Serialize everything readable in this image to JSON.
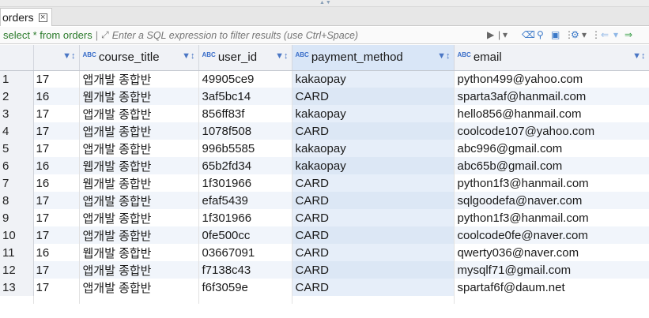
{
  "tab": {
    "label": "orders"
  },
  "filter": {
    "query": "select * from orders",
    "placeholder": "Enter a SQL expression to filter results (use Ctrl+Space)"
  },
  "columns": [
    {
      "label": "",
      "type": ""
    },
    {
      "label": "course_title",
      "type": "ABC"
    },
    {
      "label": "user_id",
      "type": "ABC"
    },
    {
      "label": "payment_method",
      "type": "ABC"
    },
    {
      "label": "email",
      "type": "ABC"
    }
  ],
  "rows": [
    {
      "rn": "1",
      "num": "17",
      "course_title": "앱개발 종합반",
      "user_id": "49905ce9",
      "payment_method": "kakaopay",
      "email": "python499@yahoo.com"
    },
    {
      "rn": "2",
      "num": "16",
      "course_title": "웹개발 종합반",
      "user_id": "3af5bc14",
      "payment_method": "CARD",
      "email": "sparta3af@hanmail.com"
    },
    {
      "rn": "3",
      "num": "17",
      "course_title": "앱개발 종합반",
      "user_id": "856ff83f",
      "payment_method": "kakaopay",
      "email": "hello856@hanmail.com"
    },
    {
      "rn": "4",
      "num": "17",
      "course_title": "앱개발 종합반",
      "user_id": "1078f508",
      "payment_method": "CARD",
      "email": "coolcode107@yahoo.com"
    },
    {
      "rn": "5",
      "num": "17",
      "course_title": "앱개발 종합반",
      "user_id": "996b5585",
      "payment_method": "kakaopay",
      "email": "abc996@gmail.com"
    },
    {
      "rn": "6",
      "num": "16",
      "course_title": "웹개발 종합반",
      "user_id": "65b2fd34",
      "payment_method": "kakaopay",
      "email": "abc65b@gmail.com"
    },
    {
      "rn": "7",
      "num": "16",
      "course_title": "웹개발 종합반",
      "user_id": "1f301966",
      "payment_method": "CARD",
      "email": "python1f3@hanmail.com"
    },
    {
      "rn": "8",
      "num": "17",
      "course_title": "앱개발 종합반",
      "user_id": "efaf5439",
      "payment_method": "CARD",
      "email": "sqlgoodefa@naver.com"
    },
    {
      "rn": "9",
      "num": "17",
      "course_title": "앱개발 종합반",
      "user_id": "1f301966",
      "payment_method": "CARD",
      "email": "python1f3@hanmail.com"
    },
    {
      "rn": "10",
      "num": "17",
      "course_title": "앱개발 종합반",
      "user_id": "0fe500cc",
      "payment_method": "CARD",
      "email": "coolcode0fe@naver.com"
    },
    {
      "rn": "11",
      "num": "16",
      "course_title": "웹개발 종합반",
      "user_id": "03667091",
      "payment_method": "CARD",
      "email": "qwerty036@naver.com"
    },
    {
      "rn": "12",
      "num": "17",
      "course_title": "앱개발 종합반",
      "user_id": "f7138c43",
      "payment_method": "CARD",
      "email": "mysqlf71@gmail.com"
    },
    {
      "rn": "13",
      "num": "17",
      "course_title": "앱개발 종합반",
      "user_id": "f6f3059e",
      "payment_method": "CARD",
      "email": "spartaf6f@daum.net"
    }
  ]
}
